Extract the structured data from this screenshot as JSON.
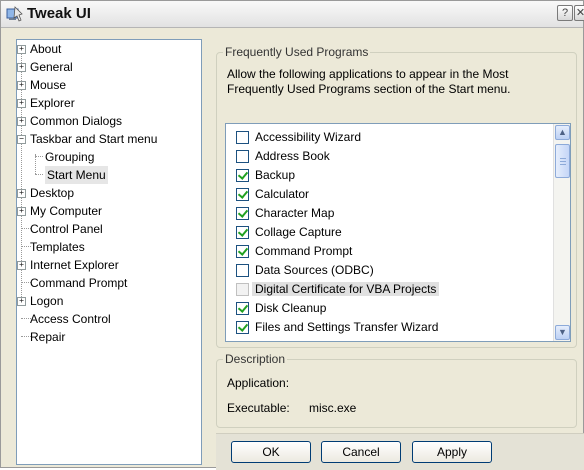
{
  "window": {
    "title": "Tweak UI",
    "help_glyph": "?",
    "close_glyph": "✕",
    "icon": "tweak-ui-icon"
  },
  "tree": {
    "items": [
      {
        "label": "About",
        "expander": "+"
      },
      {
        "label": "General",
        "expander": "+"
      },
      {
        "label": "Mouse",
        "expander": "+"
      },
      {
        "label": "Explorer",
        "expander": "+"
      },
      {
        "label": "Common Dialogs",
        "expander": "+"
      },
      {
        "label": "Taskbar and Start menu",
        "expander": "−"
      },
      {
        "label": "Grouping",
        "child": true
      },
      {
        "label": "Start Menu",
        "child": true,
        "selected": true
      },
      {
        "label": "Desktop",
        "expander": "+"
      },
      {
        "label": "My Computer",
        "expander": "+"
      },
      {
        "label": "Control Panel"
      },
      {
        "label": "Templates"
      },
      {
        "label": "Internet Explorer",
        "expander": "+"
      },
      {
        "label": "Command Prompt"
      },
      {
        "label": "Logon",
        "expander": "+"
      },
      {
        "label": "Access Control"
      },
      {
        "label": "Repair"
      }
    ]
  },
  "programs": {
    "group_title": "Frequently Used Programs",
    "description": "Allow the following applications to appear in the Most Frequently Used Programs section of the Start menu.",
    "items": [
      {
        "label": "Accessibility Wizard",
        "checked": false
      },
      {
        "label": "Address Book",
        "checked": false
      },
      {
        "label": "Backup",
        "checked": true
      },
      {
        "label": "Calculator",
        "checked": true
      },
      {
        "label": "Character Map",
        "checked": true
      },
      {
        "label": "Collage Capture",
        "checked": true
      },
      {
        "label": "Command Prompt",
        "checked": true
      },
      {
        "label": "Data Sources (ODBC)",
        "checked": false
      },
      {
        "label": "Digital Certificate for VBA Projects",
        "checked": false,
        "disabled": true,
        "highlighted": true
      },
      {
        "label": "Disk Cleanup",
        "checked": true
      },
      {
        "label": "Files and Settings Transfer Wizard",
        "checked": true
      }
    ],
    "scroll_up_glyph": "▲",
    "scroll_down_glyph": "▼"
  },
  "description": {
    "group_title": "Description",
    "application_label": "Application:",
    "application_value": "",
    "executable_label": "Executable:",
    "executable_value": "misc.exe"
  },
  "buttons": {
    "ok": "OK",
    "cancel": "Cancel",
    "apply": "Apply"
  }
}
